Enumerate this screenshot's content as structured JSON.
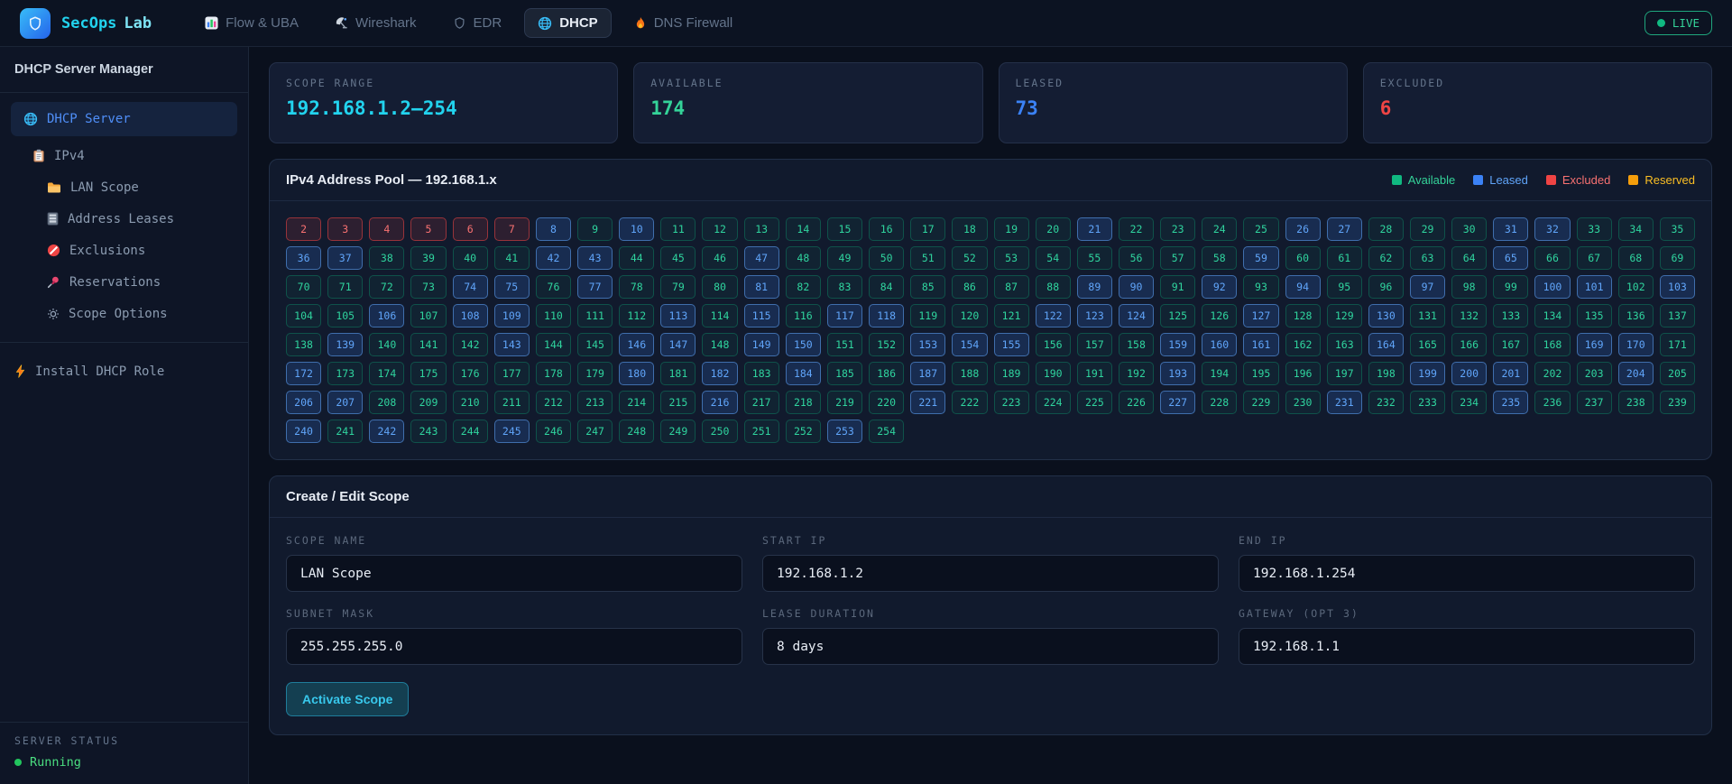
{
  "navbar": {
    "brand": {
      "primary": "SecOps",
      "secondary": "Lab"
    },
    "tabs": [
      {
        "label": "Flow & UBA",
        "icon": "bar-chart-icon",
        "active": false
      },
      {
        "label": "Wireshark",
        "icon": "antenna-icon",
        "active": false
      },
      {
        "label": "EDR",
        "icon": "shield-outline-icon",
        "active": false
      },
      {
        "label": "DHCP",
        "icon": "globe-icon",
        "active": true
      },
      {
        "label": "DNS Firewall",
        "icon": "flame-icon",
        "active": false
      }
    ],
    "live_badge": "LIVE"
  },
  "sidebar": {
    "title": "DHCP Server Manager",
    "items": [
      {
        "label": "DHCP Server",
        "icon": "globe-icon",
        "selected": true
      },
      {
        "label": "IPv4",
        "icon": "clipboard-icon"
      },
      {
        "label": "LAN Scope",
        "icon": "folder-icon"
      },
      {
        "label": "Address Leases",
        "icon": "card-file-icon"
      },
      {
        "label": "Exclusions",
        "icon": "no-entry-icon"
      },
      {
        "label": "Reservations",
        "icon": "pushpin-icon"
      },
      {
        "label": "Scope Options",
        "icon": "gear-icon"
      }
    ],
    "install_item": {
      "label": "Install DHCP Role",
      "icon": "bolt-icon"
    },
    "footer": {
      "label": "SERVER STATUS",
      "status": "Running"
    }
  },
  "stats": [
    {
      "label": "SCOPE RANGE",
      "value": "192.168.1.2–254",
      "color": "#22d3ee"
    },
    {
      "label": "AVAILABLE",
      "value": "174",
      "color": "#34d399"
    },
    {
      "label": "LEASED",
      "value": "73",
      "color": "#3b82f6"
    },
    {
      "label": "EXCLUDED",
      "value": "6",
      "color": "#ef4444"
    }
  ],
  "pool": {
    "title": "IPv4 Address Pool — 192.168.1.x",
    "legend": [
      {
        "label": "Available",
        "color": "#10b981"
      },
      {
        "label": "Leased",
        "color": "#3b82f6"
      },
      {
        "label": "Excluded",
        "color": "#ef4444"
      },
      {
        "label": "Reserved",
        "color": "#f59e0b"
      }
    ],
    "start": 2,
    "end": 254,
    "excluded": [
      2,
      3,
      4,
      5,
      6,
      7
    ],
    "leased": [
      8,
      10,
      21,
      26,
      27,
      31,
      32,
      36,
      37,
      42,
      43,
      47,
      59,
      65,
      74,
      75,
      77,
      81,
      89,
      90,
      92,
      94,
      97,
      100,
      101,
      103,
      106,
      108,
      109,
      113,
      115,
      117,
      118,
      122,
      123,
      124,
      127,
      130,
      139,
      143,
      146,
      147,
      149,
      150,
      153,
      154,
      155,
      159,
      160,
      161,
      164,
      169,
      170,
      172,
      180,
      182,
      184,
      187,
      193,
      199,
      200,
      201,
      204,
      206,
      207,
      216,
      221,
      227,
      231,
      235,
      240,
      242,
      245,
      253
    ]
  },
  "scope_form": {
    "title": "Create / Edit Scope",
    "fields": [
      {
        "label": "SCOPE NAME",
        "value": "LAN Scope"
      },
      {
        "label": "START IP",
        "value": "192.168.1.2"
      },
      {
        "label": "END IP",
        "value": "192.168.1.254"
      },
      {
        "label": "SUBNET MASK",
        "value": "255.255.255.0"
      },
      {
        "label": "LEASE DURATION",
        "value": "8 days"
      },
      {
        "label": "GATEWAY (OPT 3)",
        "value": "192.168.1.1"
      }
    ],
    "submit_label": "Activate Scope"
  }
}
